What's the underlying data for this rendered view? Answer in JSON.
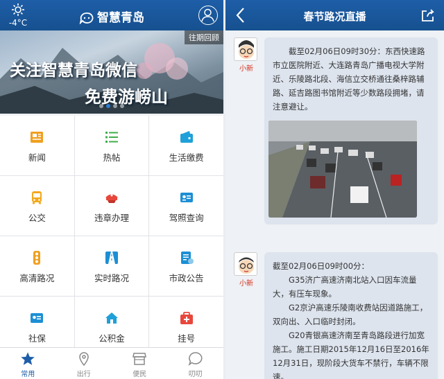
{
  "left": {
    "weather": {
      "temp": "-4°C"
    },
    "title": "智慧青岛",
    "banner": {
      "history_label": "往期回顾",
      "line1": "关注智慧青岛微信",
      "line2": "免费游崂山"
    },
    "services": [
      {
        "label": "新闻",
        "icon": "news-icon"
      },
      {
        "label": "热帖",
        "icon": "list-icon"
      },
      {
        "label": "生活缴费",
        "icon": "wallet-icon"
      },
      {
        "label": "公交",
        "icon": "bus-icon"
      },
      {
        "label": "违章办理",
        "icon": "police-cap-icon"
      },
      {
        "label": "驾照查询",
        "icon": "license-card-icon"
      },
      {
        "label": "高清路况",
        "icon": "traffic-light-icon"
      },
      {
        "label": "实时路况",
        "icon": "road-icon"
      },
      {
        "label": "市政公告",
        "icon": "notice-icon"
      },
      {
        "label": "社保",
        "icon": "id-card-icon"
      },
      {
        "label": "公积金",
        "icon": "house-icon"
      },
      {
        "label": "挂号",
        "icon": "medical-bag-icon"
      }
    ],
    "tabs": [
      {
        "label": "常用",
        "icon": "star-icon",
        "active": true
      },
      {
        "label": "出行",
        "icon": "location-pin-icon"
      },
      {
        "label": "便民",
        "icon": "shop-icon"
      },
      {
        "label": "叨叨",
        "icon": "chat-icon"
      }
    ]
  },
  "right": {
    "title": "春节路况直播",
    "posts": [
      {
        "author": "小新",
        "paras": [
          "截至02月06日09时30分：东西快速路市立医院附近、大连路青岛广播电视大学附近、乐陵路北段、海信立交桥通往桑梓路辅路、延吉路图书馆附近等少数路段拥堵，请注意避让。"
        ]
      },
      {
        "author": "小新",
        "paras": [
          "截至02月06日09时00分：",
          "G35济广高速济南北站入口因车流量大，有压车现象。",
          "G2京沪高速乐陵南收费站因道路施工，双向出、入口临时封闭。",
          "G20青银高速济南至青岛路段进行加宽施工。施工日期2015年12月16日至2016年12月31日，现阶段大货车不禁行，车辆不限速。"
        ]
      }
    ]
  },
  "colors": {
    "primary": "#1e5ea8",
    "author": "#d4301d",
    "bubble": "#dde4ee"
  }
}
